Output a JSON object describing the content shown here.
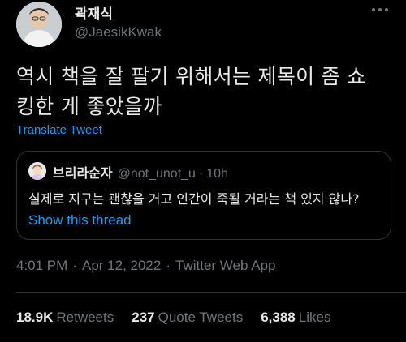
{
  "author": {
    "name": "곽재식",
    "handle": "@JaesikKwak",
    "avatar_icon": "person-avatar"
  },
  "more_icon": "more-dots-icon",
  "tweet": {
    "text": "역시 책을 잘 팔기 위해서는 제목이 좀 쇼\n킹한 게 좋았을까",
    "translate_label": "Translate Tweet"
  },
  "quote": {
    "name": "브리라순자",
    "handle": "@not_unot_u",
    "dot": "·",
    "time": "10h",
    "text": "실제로 지구는 괜찮을 거고 인간이 죽될 거라는 책 있지 않나?",
    "show_thread_label": "Show this thread"
  },
  "meta": {
    "time": "4:01 PM",
    "date": "Apr 12, 2022",
    "source": "Twitter Web App",
    "separator": "·"
  },
  "stats": {
    "retweets_count": "18.9K",
    "retweets_label": "Retweets",
    "quotes_count": "237",
    "quotes_label": "Quote Tweets",
    "likes_count": "6,388",
    "likes_label": "Likes"
  },
  "colors": {
    "background": "#000000",
    "text_primary": "#e7e9ea",
    "text_secondary": "#71767b",
    "link": "#1d9bf0",
    "border": "#2f3336"
  }
}
